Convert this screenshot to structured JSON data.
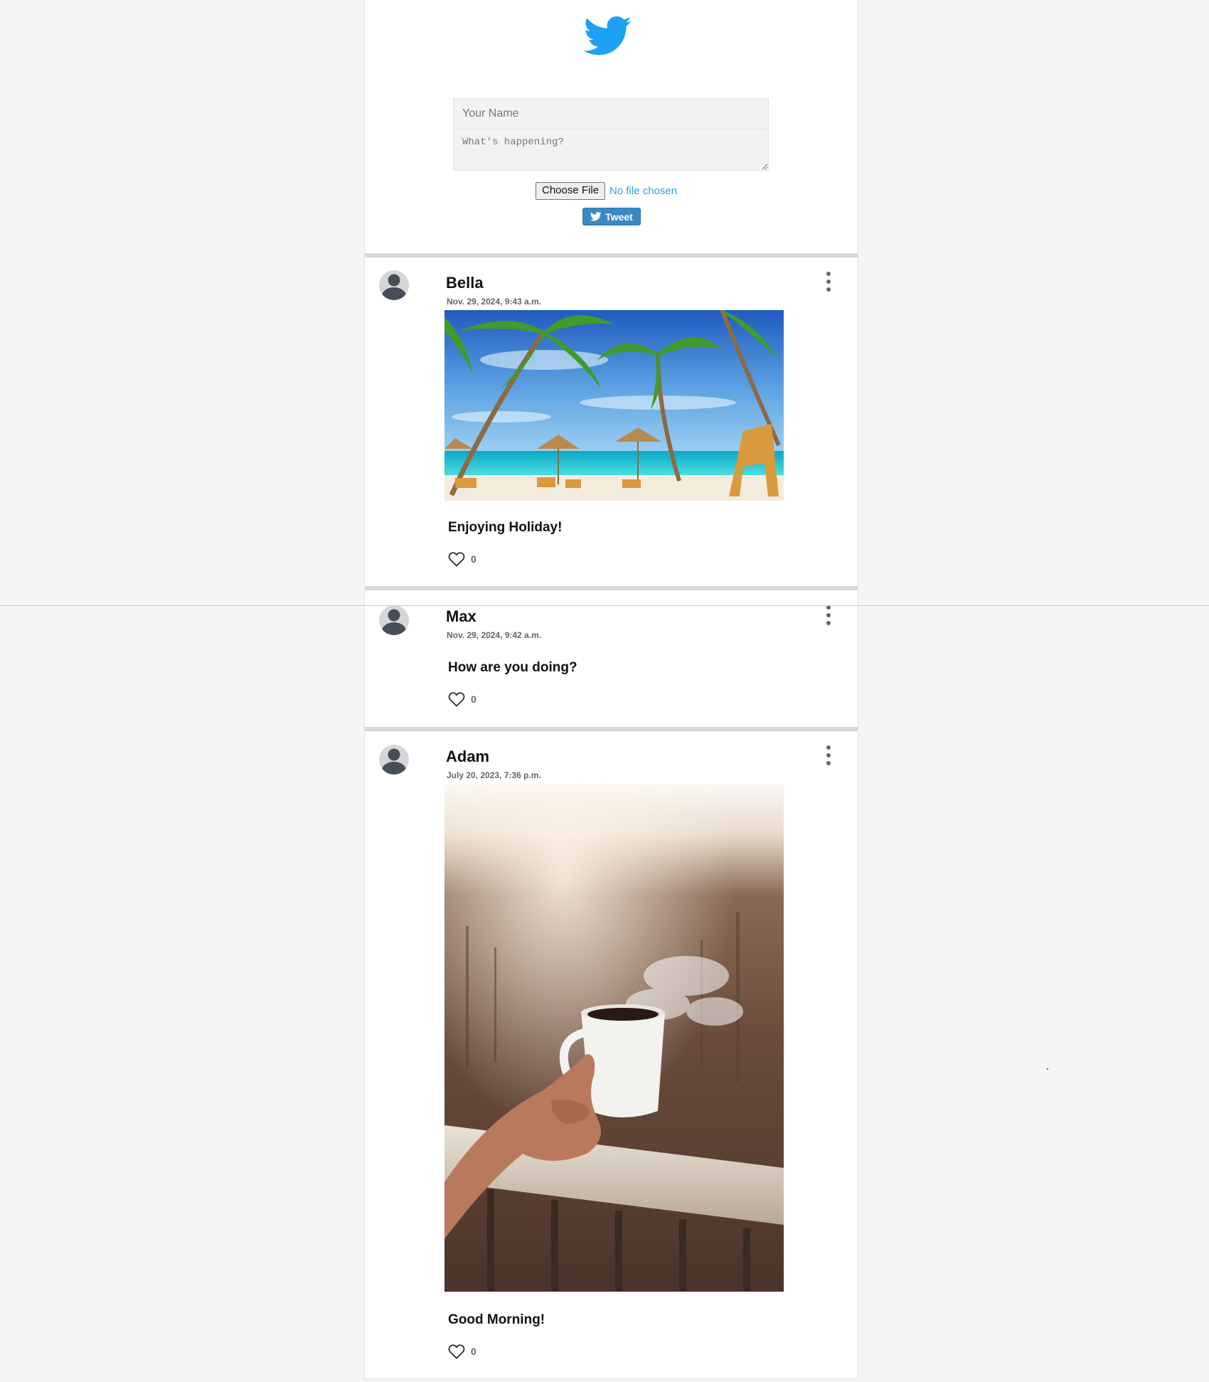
{
  "compose": {
    "name_placeholder": "Your Name",
    "status_placeholder": "What's happening?",
    "choose_file_label": "Choose File",
    "no_file_text": "No file chosen",
    "tweet_label": "Tweet",
    "logo_icon": "twitter-bird-icon",
    "brand_color": "#1da1f2",
    "button_color": "#3b88c3"
  },
  "posts": [
    {
      "author": "Bella",
      "timestamp": "Nov. 29, 2024, 9:43 a.m.",
      "text": "Enjoying Holiday!",
      "likes": "0",
      "has_image": true,
      "image_subject": "tropical beach with palm trees"
    },
    {
      "author": "Max",
      "timestamp": "Nov. 29, 2024, 9:42 a.m.",
      "text": "How are you doing?",
      "likes": "0",
      "has_image": false
    },
    {
      "author": "Adam",
      "timestamp": "July 20, 2023, 7:36 p.m.",
      "text": "Good Morning!",
      "likes": "0",
      "has_image": true,
      "image_subject": "hand holding steaming coffee cup"
    }
  ]
}
